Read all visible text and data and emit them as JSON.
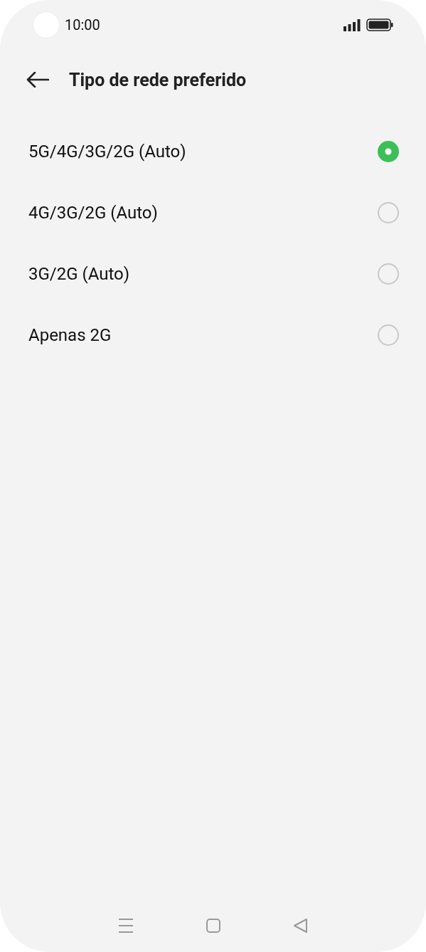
{
  "status_bar": {
    "time": "10:00"
  },
  "header": {
    "title": "Tipo de rede preferido"
  },
  "options": [
    {
      "label": "5G/4G/3G/2G (Auto)",
      "selected": true
    },
    {
      "label": "4G/3G/2G (Auto)",
      "selected": false
    },
    {
      "label": "3G/2G (Auto)",
      "selected": false
    },
    {
      "label": "Apenas 2G",
      "selected": false
    }
  ]
}
